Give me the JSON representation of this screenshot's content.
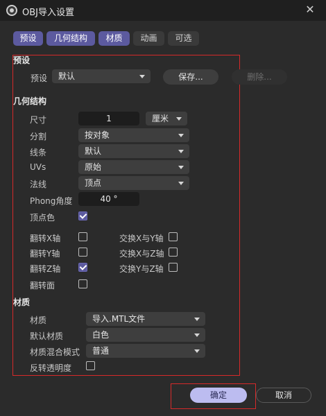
{
  "window": {
    "title": "OBJ导入设置",
    "close_glyph": "✕"
  },
  "tabs": [
    {
      "label": "预设",
      "active": true
    },
    {
      "label": "几何结构",
      "active": true
    },
    {
      "label": "材质",
      "active": true
    },
    {
      "label": "动画",
      "active": false
    },
    {
      "label": "可选",
      "active": false
    }
  ],
  "preset": {
    "section_title": "预设",
    "label": "预设",
    "value": "默认",
    "save_label": "保存...",
    "delete_label": "删除..."
  },
  "geometry": {
    "section_title": "几何结构",
    "size_label": "尺寸",
    "size_value": "1",
    "unit_value": "厘米",
    "split_label": "分割",
    "split_value": "按对象",
    "lines_label": "线条",
    "lines_value": "默认",
    "uvs_label": "UVs",
    "uvs_value": "原始",
    "normals_label": "法线",
    "normals_value": "顶点",
    "phong_label": "Phong角度",
    "phong_value": "40 °",
    "vertex_color_label": "顶点色",
    "vertex_color_checked": true,
    "flip_x_label": "翻转X轴",
    "flip_x_checked": false,
    "flip_y_label": "翻转Y轴",
    "flip_y_checked": false,
    "flip_z_label": "翻转Z轴",
    "flip_z_checked": true,
    "flip_faces_label": "翻转面",
    "flip_faces_checked": false,
    "swap_xy_label": "交换X与Y轴",
    "swap_xy_checked": false,
    "swap_xz_label": "交换X与Z轴",
    "swap_xz_checked": false,
    "swap_yz_label": "交换Y与Z轴",
    "swap_yz_checked": false
  },
  "material": {
    "section_title": "材质",
    "material_label": "材质",
    "material_value": "导入.MTL文件",
    "default_material_label": "默认材质",
    "default_material_value": "白色",
    "blend_mode_label": "材质混合模式",
    "blend_mode_value": "普通",
    "invert_transparency_label": "反转透明度",
    "invert_transparency_checked": false
  },
  "footer": {
    "ok_label": "确定",
    "cancel_label": "取消"
  },
  "colors": {
    "accent": "#5c5a9f",
    "ok_button": "#bcbcf0",
    "highlight_box": "#d72a2a"
  }
}
